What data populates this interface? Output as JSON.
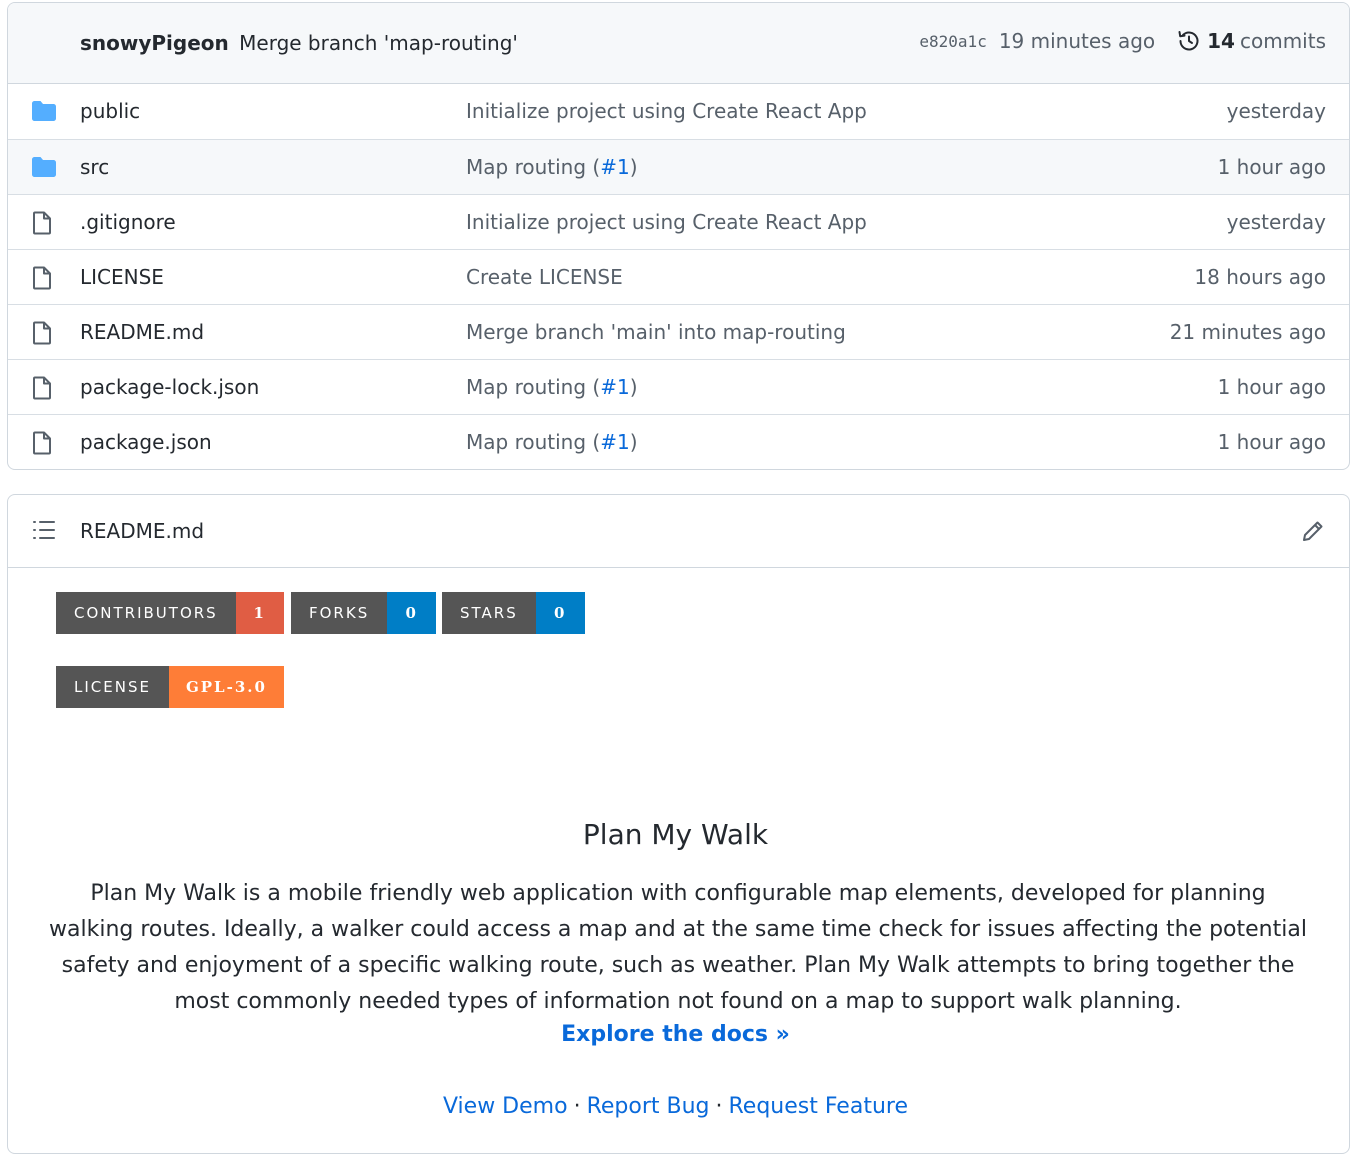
{
  "commit": {
    "author": "snowyPigeon",
    "message": "Merge branch 'map-routing'",
    "sha": "e820a1c",
    "time": "19 minutes ago",
    "commit_count": "14",
    "commits_label": "commits"
  },
  "files": [
    {
      "name": "public",
      "type": "folder",
      "message": "Initialize project using Create React App",
      "date": "yesterday"
    },
    {
      "name": "src",
      "type": "folder",
      "message_pre": "Map routing (",
      "issue": "#1",
      "message_post": ")",
      "date": "1 hour ago"
    },
    {
      "name": ".gitignore",
      "type": "file",
      "message": "Initialize project using Create React App",
      "date": "yesterday"
    },
    {
      "name": "LICENSE",
      "type": "file",
      "message": "Create LICENSE",
      "date": "18 hours ago"
    },
    {
      "name": "README.md",
      "type": "file",
      "message": "Merge branch 'main' into map-routing",
      "date": "21 minutes ago"
    },
    {
      "name": "package-lock.json",
      "type": "file",
      "message_pre": "Map routing (",
      "issue": "#1",
      "message_post": ")",
      "date": "1 hour ago"
    },
    {
      "name": "package.json",
      "type": "file",
      "message_pre": "Map routing (",
      "issue": "#1",
      "message_post": ")",
      "date": "1 hour ago"
    }
  ],
  "readme": {
    "filename": "README.md",
    "badges": [
      {
        "label": "CONTRIBUTORS",
        "value": "1",
        "color": "#e05d44"
      },
      {
        "label": "FORKS",
        "value": "0",
        "color": "#007ec6"
      },
      {
        "label": "STARS",
        "value": "0",
        "color": "#007ec6"
      },
      {
        "label": "LICENSE",
        "value": "GPL-3.0",
        "color": "#fe7d37"
      }
    ],
    "title": "Plan My Walk",
    "description": "Plan My Walk is a mobile friendly web application with configurable map elements, developed for planning walking routes. Ideally, a walker could access a map and at the same time check for issues affecting the potential safety and enjoyment of a specific walking route, such as weather. Plan My Walk attempts to bring together the most commonly needed types of information not found on a map to support walk planning.",
    "docs_link": "Explore the docs »",
    "links": [
      "View Demo",
      "Report Bug",
      "Request Feature"
    ],
    "separator": "·"
  },
  "colors": {
    "folder": "#54aeff",
    "link": "#0969da",
    "muted": "#57606a",
    "badge_label": "#555555"
  }
}
